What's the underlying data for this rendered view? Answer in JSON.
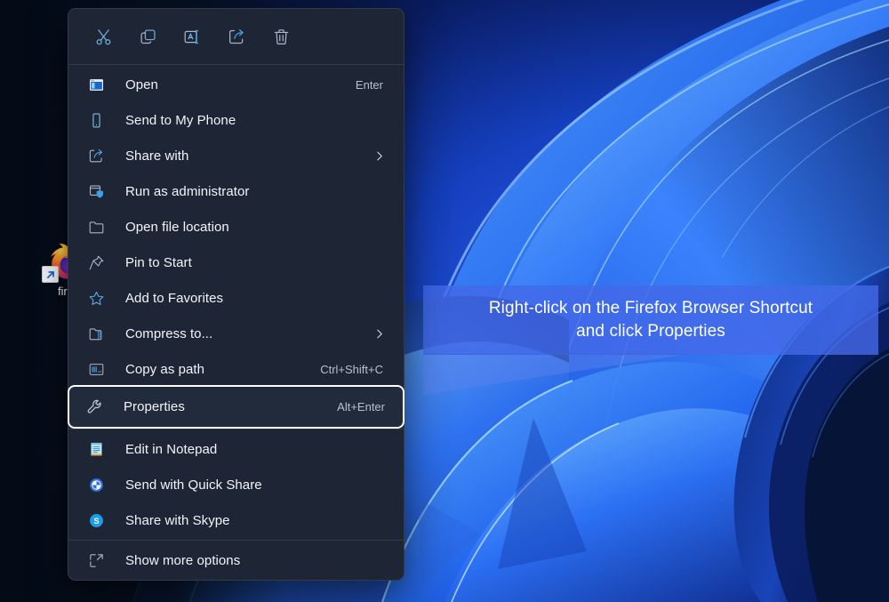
{
  "desktop": {
    "icon": {
      "name": "firefox-shortcut",
      "label": "fire",
      "badge": "shortcut-arrow-icon"
    },
    "wallpaper_name": "windows-11-bloom-blue",
    "colors": {
      "bg_dark": "#050d1a",
      "ribbon_bright": "#4aa3ff",
      "ribbon_mid": "#1f5bef",
      "ribbon_deep": "#0b1f6b"
    }
  },
  "context_menu": {
    "toolbar": [
      {
        "name": "cut-icon",
        "label": "Cut"
      },
      {
        "name": "copy-icon",
        "label": "Copy"
      },
      {
        "name": "rename-icon",
        "label": "Rename"
      },
      {
        "name": "share-icon",
        "label": "Share"
      },
      {
        "name": "delete-icon",
        "label": "Delete"
      }
    ],
    "groups": [
      {
        "items": [
          {
            "icon": "open-window-icon",
            "label": "Open",
            "accel": "Enter",
            "submenu": false,
            "focused": false
          },
          {
            "icon": "phone-icon",
            "label": "Send to My Phone",
            "accel": "",
            "submenu": false,
            "focused": false
          },
          {
            "icon": "share-with-icon",
            "label": "Share with",
            "accel": "",
            "submenu": true,
            "focused": false
          },
          {
            "icon": "shield-admin-icon",
            "label": "Run as administrator",
            "accel": "",
            "submenu": false,
            "focused": false
          },
          {
            "icon": "folder-icon",
            "label": "Open file location",
            "accel": "",
            "submenu": false,
            "focused": false
          },
          {
            "icon": "pin-icon",
            "label": "Pin to Start",
            "accel": "",
            "submenu": false,
            "focused": false
          },
          {
            "icon": "star-icon",
            "label": "Add to Favorites",
            "accel": "",
            "submenu": false,
            "focused": false
          },
          {
            "icon": "compress-icon",
            "label": "Compress to...",
            "accel": "",
            "submenu": true,
            "focused": false
          },
          {
            "icon": "copy-path-icon",
            "label": "Copy as path",
            "accel": "Ctrl+Shift+C",
            "submenu": false,
            "focused": false
          },
          {
            "icon": "wrench-icon",
            "label": "Properties",
            "accel": "Alt+Enter",
            "submenu": false,
            "focused": true
          }
        ]
      },
      {
        "items": [
          {
            "icon": "notepad-icon",
            "label": "Edit in Notepad",
            "accel": "",
            "submenu": false,
            "focused": false
          },
          {
            "icon": "quick-share-icon",
            "label": "Send with Quick Share",
            "accel": "",
            "submenu": false,
            "focused": false
          },
          {
            "icon": "skype-icon",
            "label": "Share with Skype",
            "accel": "",
            "submenu": false,
            "focused": false
          }
        ]
      },
      {
        "items": [
          {
            "icon": "show-more-icon",
            "label": "Show more options",
            "accel": "",
            "submenu": false,
            "focused": false
          }
        ]
      }
    ],
    "colors": {
      "background": "#1e2534",
      "text": "#f3f5f9",
      "accel_text": "#b9c0cc",
      "focus_ring": "#ffffff"
    }
  },
  "callout": {
    "line1": "Right-click on the Firefox Browser Shortcut",
    "line2": "and click Properties",
    "color": "#4369e8"
  }
}
